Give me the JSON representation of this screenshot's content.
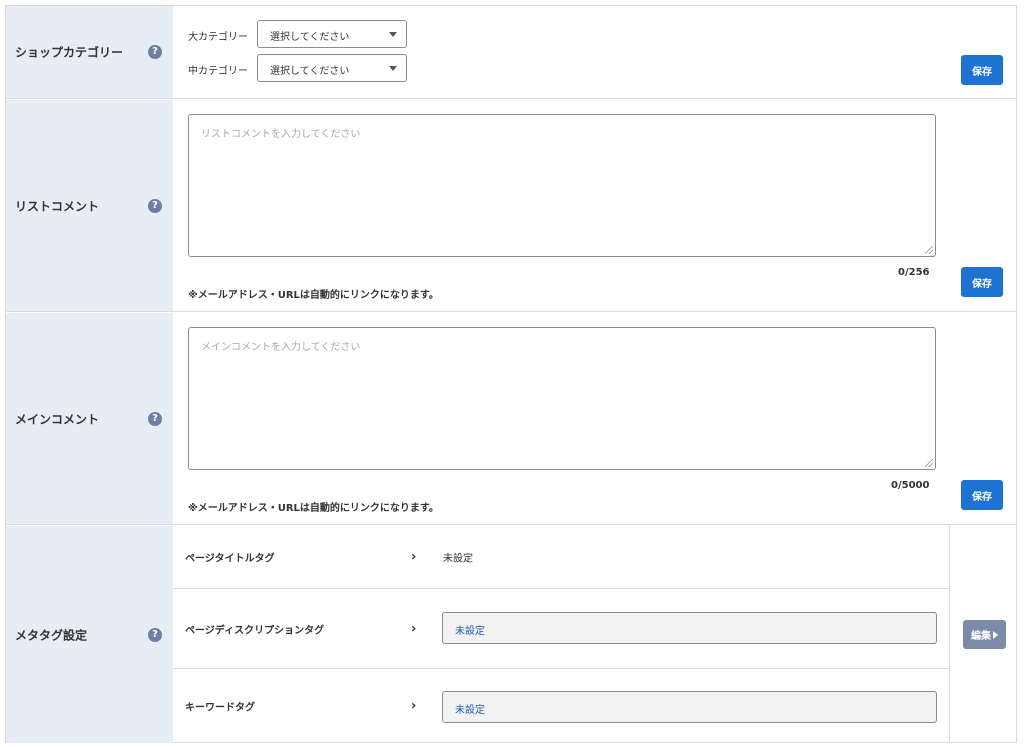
{
  "shop_category": {
    "label": "ショップカテゴリー",
    "help": "?",
    "large_label": "大カテゴリー",
    "large_value": "選択してください",
    "mid_label": "中カテゴリー",
    "mid_value": "選択してください",
    "save_label": "保存"
  },
  "list_comment": {
    "label": "リストコメント",
    "help": "?",
    "placeholder": "リストコメントを入力してください",
    "counter": "0/256",
    "note": "※メールアドレス・URLは自動的にリンクになります。",
    "save_label": "保存"
  },
  "main_comment": {
    "label": "メインコメント",
    "help": "?",
    "placeholder": "メインコメントを入力してください",
    "counter": "0/5000",
    "note": "※メールアドレス・URLは自動的にリンクになります。",
    "save_label": "保存"
  },
  "meta_tags": {
    "label": "メタタグ設定",
    "help": "?",
    "items": [
      {
        "name": "ページタイトルタグ",
        "value": "未設定"
      },
      {
        "name": "ページディスクリプションタグ",
        "value": "未設定"
      },
      {
        "name": "キーワードタグ",
        "value": "未設定"
      }
    ],
    "chevron": "›",
    "edit_label": "編集"
  },
  "colors": {
    "label_bg": "#e6edf5",
    "save_button": "#1e72d2",
    "edit_button": "#7b8cab",
    "help_icon": "#6f7ea3",
    "link_value": "#1f5fa8"
  }
}
